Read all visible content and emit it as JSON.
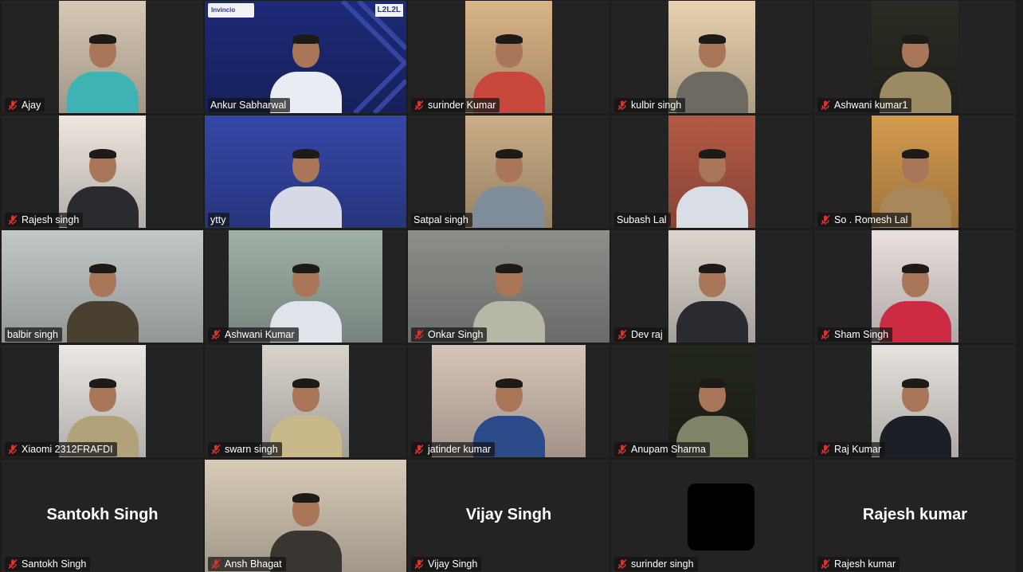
{
  "meeting": {
    "participants": [
      {
        "name": "Ajay",
        "muted": true,
        "bg": "#d6c8b4",
        "shirt": "#3fb2b3"
      },
      {
        "name": "Ankur Sabharwal",
        "muted": false,
        "speaking": true,
        "bg": "#1d2a78",
        "shirt": "#e9ecf2",
        "logo": "Invincio",
        "logo2": "L2L2L"
      },
      {
        "name": "surinder Kumar",
        "muted": true,
        "bg": "#d9b487",
        "shirt": "#c8473c"
      },
      {
        "name": "kulbir singh",
        "muted": true,
        "bg": "#e8d1ad",
        "shirt": "#6c6a62"
      },
      {
        "name": "Ashwani kumar1",
        "muted": true,
        "bg": "#2b2b24",
        "shirt": "#9b8a64"
      },
      {
        "name": "Rajesh singh",
        "muted": true,
        "bg": "#ede7df",
        "shirt": "#2a2b2e"
      },
      {
        "name": "ytty",
        "muted": false,
        "bg": "#3447a6",
        "shirt": "#d7d9e6"
      },
      {
        "name": "Satpal singh",
        "muted": false,
        "bg": "#c9ad86",
        "shirt": "#7f8c99"
      },
      {
        "name": "Subash Lal",
        "muted": false,
        "bg": "#b45a46",
        "shirt": "#d9dde6"
      },
      {
        "name": "So . Romesh Lal",
        "muted": true,
        "bg": "#d39a4f",
        "shirt": "#a8875a"
      },
      {
        "name": "balbir singh",
        "muted": false,
        "bg": "#c2c8c8",
        "shirt": "#49402f"
      },
      {
        "name": "Ashwani Kumar",
        "muted": true,
        "bg": "#9fb0a6",
        "shirt": "#dfe4ea"
      },
      {
        "name": "Onkar Singh",
        "muted": true,
        "bg": "#8c8f8a",
        "shirt": "#b7b7a7"
      },
      {
        "name": "Dev raj",
        "muted": true,
        "bg": "#dcd5cd",
        "shirt": "#2a2b30"
      },
      {
        "name": "Sham Singh",
        "muted": true,
        "bg": "#e9e0df",
        "shirt": "#cb2b43"
      },
      {
        "name": "Xiaomi 2312FRAFDI",
        "muted": true,
        "bg": "#ece8e4",
        "shirt": "#b1a27a"
      },
      {
        "name": "swarn singh",
        "muted": true,
        "bg": "#d9d3cc",
        "shirt": "#c9b98a"
      },
      {
        "name": "jatinder kumar",
        "muted": true,
        "bg": "#d7c4b8",
        "shirt": "#2a4a8a"
      },
      {
        "name": "Anupam Sharma",
        "muted": true,
        "bg": "#22271c",
        "shirt": "#7f8467"
      },
      {
        "name": "Raj Kumar",
        "muted": true,
        "bg": "#e6e2dd",
        "shirt": "#1d1f27"
      },
      {
        "name": "Santokh Singh",
        "muted": true,
        "avatar": "Santokh Singh"
      },
      {
        "name": "Ansh Bhagat",
        "muted": true,
        "bg": "#d7cbb7",
        "shirt": "#3a3530"
      },
      {
        "name": "Vijay Singh",
        "muted": true,
        "avatar": "Vijay Singh"
      },
      {
        "name": "surinder singh",
        "muted": true,
        "blank": true
      },
      {
        "name": "Rajesh kumar",
        "muted": true,
        "avatar": "Rajesh kumar"
      }
    ]
  },
  "colors": {
    "mute": "#e0312a",
    "speaking": "#2fb86a",
    "tile": "#232323",
    "background": "#1c1c1c"
  },
  "icons": {
    "mute": "mic-muted-icon"
  }
}
